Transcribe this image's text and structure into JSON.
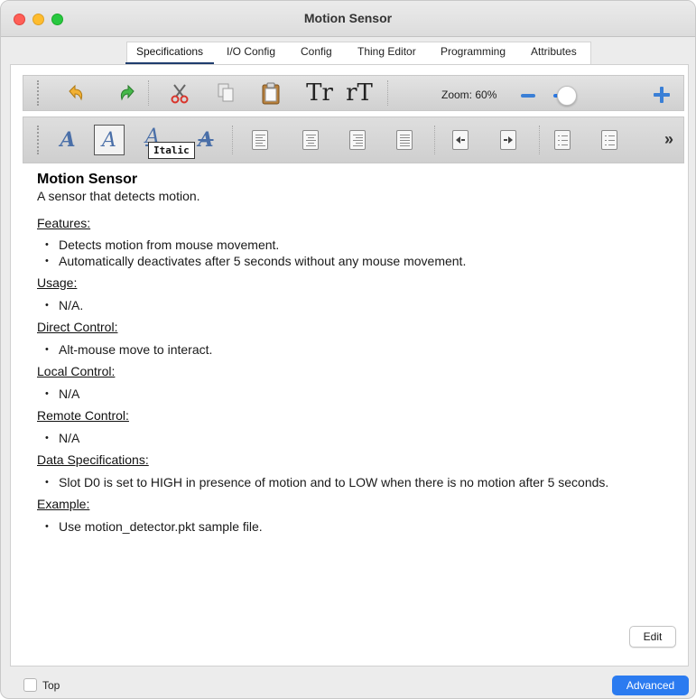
{
  "window": {
    "title": "Motion Sensor"
  },
  "tabs": [
    {
      "label": "Specifications",
      "active": true
    },
    {
      "label": "I/O Config"
    },
    {
      "label": "Config"
    },
    {
      "label": "Thing Editor"
    },
    {
      "label": "Programming"
    },
    {
      "label": "Attributes"
    }
  ],
  "toolbar": {
    "icons": [
      "undo-icon",
      "redo-icon",
      "cut-icon",
      "copy-icon",
      "paste-icon",
      "increase-font-icon",
      "decrease-font-icon"
    ],
    "font_glyph_1": "Tr",
    "font_glyph_2": "rT",
    "zoom_label": "Zoom: 60%",
    "zoom_level_percent": 60
  },
  "format_bar": {
    "tooltip": "Italic",
    "more_glyph": "»",
    "buttons": [
      "bold",
      "italic",
      "underline",
      "strikethrough",
      "align-left",
      "align-center",
      "align-right",
      "align-justify",
      "outdent",
      "indent",
      "numbered-list",
      "bulleted-list"
    ]
  },
  "doc": {
    "title": "Motion Sensor",
    "subtitle": "A sensor that detects motion.",
    "sections": [
      {
        "heading": "Features:",
        "items": [
          "Detects motion from mouse movement.",
          "Automatically deactivates after 5 seconds without any mouse movement."
        ]
      },
      {
        "heading": "Usage:",
        "items": [
          "N/A."
        ]
      },
      {
        "heading": "Direct Control:",
        "items": [
          "Alt-mouse move to interact."
        ]
      },
      {
        "heading": "Local Control:",
        "items": [
          "N/A"
        ]
      },
      {
        "heading": "Remote Control:",
        "items": [
          "N/A"
        ]
      },
      {
        "heading": "Data Specifications:",
        "items": [
          "Slot D0 is set to HIGH in presence of motion and to LOW when there is no motion after 5 seconds."
        ]
      },
      {
        "heading": "Example:",
        "items": [
          "Use motion_detector.pkt sample file."
        ]
      }
    ]
  },
  "buttons": {
    "edit": "Edit",
    "advanced": "Advanced"
  },
  "footer": {
    "top_label": "Top",
    "top_checked": false
  },
  "colors": {
    "accent": "#2b7bf0",
    "tab_underline": "#1f3d6e"
  }
}
